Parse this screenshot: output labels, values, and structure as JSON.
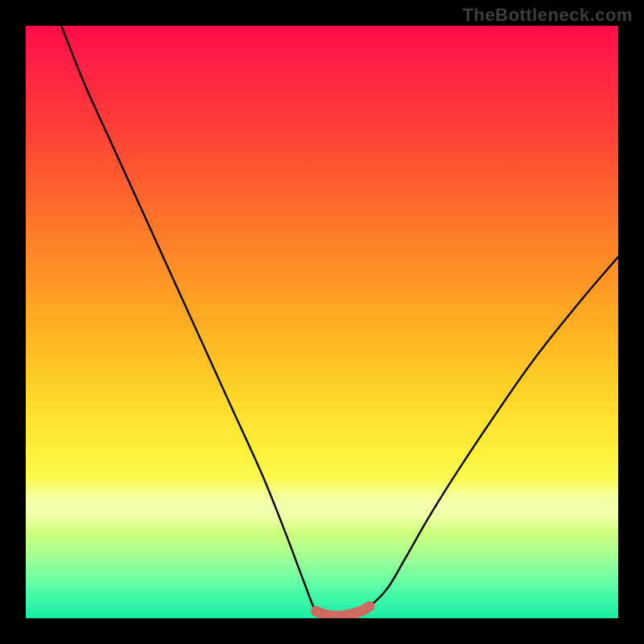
{
  "watermark": "TheBottleneck.com",
  "chart_data": {
    "type": "line",
    "title": "",
    "xlabel": "",
    "ylabel": "",
    "xlim": [
      0,
      100
    ],
    "ylim": [
      0,
      100
    ],
    "grid": false,
    "legend": false,
    "series": [
      {
        "name": "curve",
        "x": [
          6,
          10,
          15,
          20,
          25,
          30,
          35,
          40,
          44,
          47,
          49,
          51,
          53,
          56,
          58,
          61,
          64,
          68,
          73,
          79,
          86,
          94,
          100
        ],
        "values": [
          100,
          90,
          79,
          68,
          57,
          46,
          35,
          24,
          14,
          6,
          1.2,
          0.4,
          0.4,
          1.2,
          2.0,
          5,
          10,
          17,
          25,
          34,
          44,
          54,
          61
        ]
      },
      {
        "name": "floor-marker",
        "x": [
          49,
          50,
          51,
          52,
          53,
          54,
          55,
          56,
          57,
          58
        ],
        "values": [
          1.2,
          0.8,
          0.5,
          0.4,
          0.4,
          0.5,
          0.7,
          1.0,
          1.4,
          2.0
        ]
      }
    ],
    "background_gradient": {
      "direction": "vertical",
      "stops": [
        {
          "pos": 0.0,
          "color": "#ff0a4a"
        },
        {
          "pos": 0.3,
          "color": "#ff6a2c"
        },
        {
          "pos": 0.55,
          "color": "#ffba22"
        },
        {
          "pos": 0.72,
          "color": "#fff13a"
        },
        {
          "pos": 0.85,
          "color": "#c1ff86"
        },
        {
          "pos": 1.0,
          "color": "#18eca3"
        }
      ]
    },
    "pale_band_y_range": [
      76.5,
      85.5
    ]
  }
}
